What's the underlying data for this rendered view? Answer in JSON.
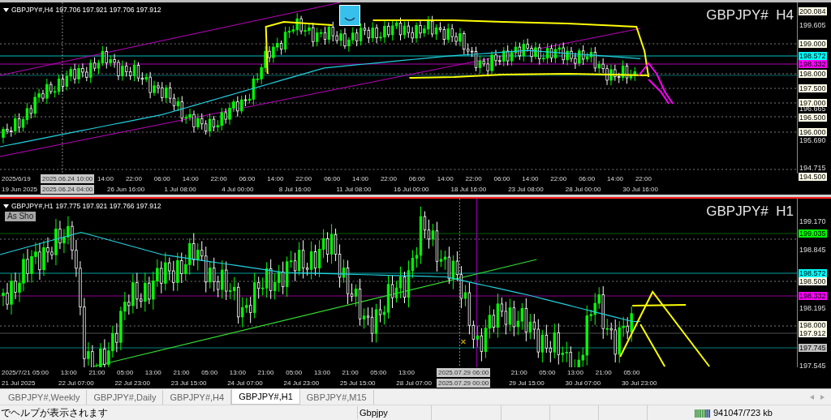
{
  "charts": [
    {
      "symbol": "GBPJPY#,H4",
      "quote": "197.706 197.921 197.706 197.912",
      "title": "GBPJPY#  H4",
      "price_labels": [
        {
          "text": "200.084",
          "kind": "box",
          "color": "#fffde8"
        },
        {
          "text": "199.605",
          "kind": "tick"
        },
        {
          "text": "199.000",
          "kind": "box",
          "color": "#fffde8"
        },
        {
          "text": "198.572",
          "kind": "box",
          "color": "#00ffff"
        },
        {
          "text": "198.332",
          "kind": "box",
          "color": "#ff00ff"
        },
        {
          "text": "198.000",
          "kind": "box",
          "color": "#fffde8"
        },
        {
          "text": "197.500",
          "kind": "box",
          "color": "#fffde8"
        },
        {
          "text": "197.000",
          "kind": "box",
          "color": "#fffde8"
        },
        {
          "text": "196.665",
          "kind": "tick"
        },
        {
          "text": "196.500",
          "kind": "box",
          "color": "#fffde8"
        },
        {
          "text": "196.000",
          "kind": "box",
          "color": "#fffde8"
        },
        {
          "text": "195.690",
          "kind": "tick"
        },
        {
          "text": "194.715",
          "kind": "tick"
        },
        {
          "text": "194.500",
          "kind": "box",
          "color": "#fffde8"
        }
      ],
      "time_upper": [
        "2025/6/19",
        "14:00",
        "22:00",
        "06:00",
        "14:00",
        "22:00",
        "06:00",
        "14:00",
        "22:00",
        "06:00",
        "14:00",
        "22:00",
        "06:00",
        "14:00",
        "22:00",
        "06:00",
        "14:00",
        "22:00",
        "06:00",
        "14:00",
        "22:00"
      ],
      "time_lower": [
        "19 Jun 2025",
        "26 Jun 16:00",
        "1 Jul 08:00",
        "4 Jul 00:00",
        "8 Jul 16:00",
        "11 Jul 08:00",
        "16 Jul 00:00",
        "18 Jul 16:00",
        "23 Jul 08:00",
        "28 Jul 00:00",
        "30 Jul 16:00"
      ],
      "crosshair_upper": "2025.06.24 10:00",
      "crosshair_lower": "2025.06.24 04:00"
    },
    {
      "symbol": "GBPJPY#,H1",
      "quote": "197.775 197.921 197.766 197.912",
      "title": "GBPJPY#  H1",
      "button": "As Sho",
      "price_labels": [
        {
          "text": "199.170",
          "kind": "tick"
        },
        {
          "text": "199.035",
          "kind": "box",
          "color": "#00ff00"
        },
        {
          "text": "198.845",
          "kind": "tick"
        },
        {
          "text": "198.572",
          "kind": "box",
          "color": "#00ffff"
        },
        {
          "text": "198.500",
          "kind": "box",
          "color": "#fffde8"
        },
        {
          "text": "198.332",
          "kind": "box",
          "color": "#ff00ff"
        },
        {
          "text": "198.195",
          "kind": "tick"
        },
        {
          "text": "198.000",
          "kind": "box",
          "color": "#fffde8"
        },
        {
          "text": "197.912",
          "kind": "box",
          "color": "#fffde8"
        },
        {
          "text": "197.745",
          "kind": "box",
          "color": "#c0c0c0"
        },
        {
          "text": "197.545",
          "kind": "tick"
        }
      ],
      "time_upper": [
        "2025/7/21",
        "05:00",
        "13:00",
        "21:00",
        "05:00",
        "13:00",
        "21:00",
        "05:00",
        "13:00",
        "21:00",
        "05:00",
        "13:00",
        "21:00",
        "05:00",
        "13:00",
        "21:00",
        "05:00",
        "13:00",
        "21:00",
        "05:00"
      ],
      "time_lower": [
        "21 Jul 2025",
        "22 Jul 07:00",
        "22 Jul 23:00",
        "23 Jul 15:00",
        "24 Jul 07:00",
        "24 Jul 23:00",
        "25 Jul 15:00",
        "28 Jul 07:00",
        "29 Jul 15:00",
        "30 Jul 07:00",
        "30 Jul 23:00"
      ],
      "crosshair_upper": "2025.07.29 06:00",
      "crosshair_lower": "2025.07.29 00:00"
    }
  ],
  "tabs": [
    {
      "label": "GBPJPY#,Weekly",
      "selected": false
    },
    {
      "label": "GBPJPY#,Daily",
      "selected": false
    },
    {
      "label": "GBPJPY#,H4",
      "selected": false
    },
    {
      "label": "GBPJPY#,H1",
      "selected": true
    },
    {
      "label": "GBPJPY#,M15",
      "selected": false
    }
  ],
  "status_bar": {
    "help": "でヘルプが表示されます",
    "symbol": "Gbpjpy",
    "traffic": "941047/723 kb"
  }
}
